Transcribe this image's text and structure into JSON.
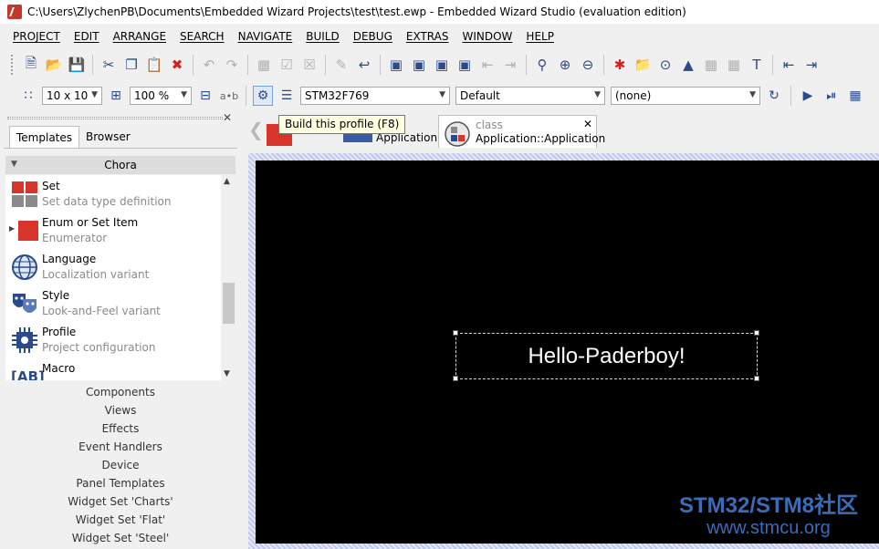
{
  "window": {
    "title": "C:\\Users\\ZlychenPB\\Documents\\Embedded Wizard Projects\\test\\test.ewp - Embedded Wizard Studio (evaluation edition)"
  },
  "menubar": {
    "items": [
      "PROJECT",
      "EDIT",
      "ARRANGE",
      "SEARCH",
      "NAVIGATE",
      "BUILD",
      "DEBUG",
      "EXTRAS",
      "WINDOW",
      "HELP"
    ]
  },
  "toolbar2": {
    "grid": "10 x 10",
    "zoom": "100 %",
    "ab_label": "a•b",
    "profile": "STM32F769",
    "style": "Default",
    "language": "(none)"
  },
  "tooltip": "Build this profile (F8)",
  "left_panel": {
    "tabs": [
      "Templates",
      "Browser"
    ],
    "group": "Chora",
    "items": [
      {
        "name": "Set",
        "desc": "Set data type definition"
      },
      {
        "name": "Enum or Set Item",
        "desc": "Enumerator"
      },
      {
        "name": "Language",
        "desc": "Localization variant"
      },
      {
        "name": "Style",
        "desc": "Look-and-Feel variant"
      },
      {
        "name": "Profile",
        "desc": "Project configuration"
      },
      {
        "name": "Macro",
        "desc": ""
      }
    ],
    "macro_icon_text": "[AB]",
    "categories": [
      "Components",
      "Views",
      "Effects",
      "Event Handlers",
      "Device",
      "Panel Templates",
      "Widget Set 'Charts'",
      "Widget Set 'Flat'",
      "Widget Set 'Steel'"
    ]
  },
  "doc_tabs": [
    {
      "type": "",
      "label": "Application"
    },
    {
      "type": "class",
      "label": "Application::Application"
    }
  ],
  "canvas": {
    "text": "Hello-Paderboy!",
    "background": "#000000",
    "text_color": "#ffffff"
  },
  "watermark": {
    "line1": "STM32/STM8社区",
    "line2": "www.stmcu.org"
  },
  "colors": {
    "accent": "#2b4a8a",
    "red": "#d32020"
  }
}
